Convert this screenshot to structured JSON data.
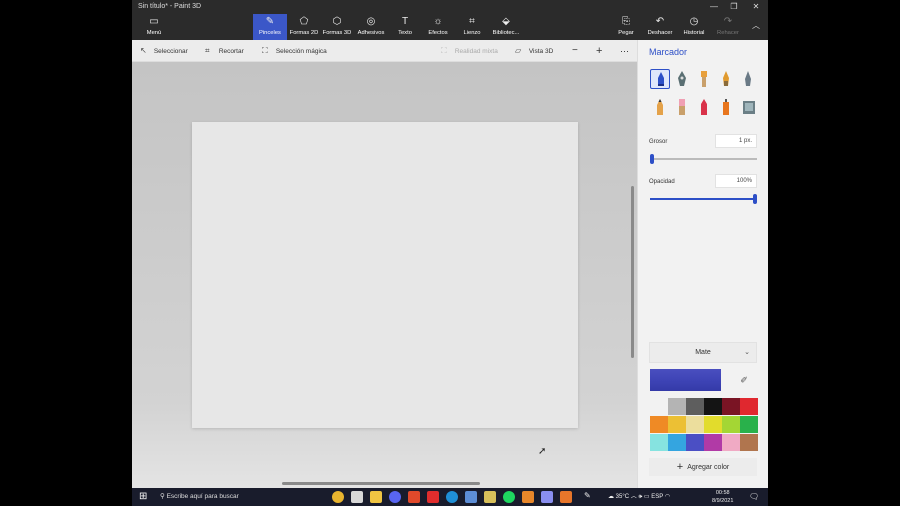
{
  "window": {
    "title": "Sin título* - Paint 3D"
  },
  "ribbon": {
    "menu": "Menú",
    "tools": [
      {
        "label": "Pinceles",
        "icon": "brush-icon"
      },
      {
        "label": "Formas 2D",
        "icon": "shapes-2d-icon"
      },
      {
        "label": "Formas 3D",
        "icon": "cube-icon"
      },
      {
        "label": "Adhesivos",
        "icon": "sticker-icon"
      },
      {
        "label": "Texto",
        "icon": "text-icon"
      },
      {
        "label": "Efectos",
        "icon": "effects-icon"
      },
      {
        "label": "Lienzo",
        "icon": "canvas-icon"
      },
      {
        "label": "Bibliotec...",
        "icon": "library-icon"
      }
    ],
    "paste": "Pegar",
    "undo": "Deshacer",
    "history": "Historial",
    "redo": "Rehacer"
  },
  "toolbar": {
    "select": "Seleccionar",
    "crop": "Recortar",
    "magic_select": "Selección mágica",
    "mixed_reality": "Realidad mixta",
    "view3d": "Vista 3D"
  },
  "panel": {
    "title": "Marcador",
    "thickness_label": "Grosor",
    "thickness_value": "1 px.",
    "thickness_fraction": 0.01,
    "opacity_label": "Opacidad",
    "opacity_value": "100%",
    "opacity_fraction": 1.0,
    "finish": "Mate",
    "current_color": "#3d43b5",
    "add_color": "Agregar color",
    "brushes": [
      "marker-icon",
      "calligraphy-pen-icon",
      "oil-brush-icon",
      "watercolor-icon",
      "pixel-pen-icon",
      "pencil-icon",
      "eraser-icon",
      "crayon-icon",
      "spray-can-icon",
      "fill-bucket-icon"
    ],
    "palette": [
      "#f2f2f2",
      "#b4b4b4",
      "#5e5e5e",
      "#141414",
      "#7a1424",
      "#e0282f",
      "#ef8a25",
      "#ecc034",
      "#ecde9d",
      "#e2dc2c",
      "#a4d634",
      "#29b14b",
      "#86e3e0",
      "#34a5e0",
      "#4b4fc4",
      "#b13aa6",
      "#f0aac4",
      "#b0754e"
    ]
  },
  "taskbar": {
    "search_placeholder": "Escribe aquí para buscar",
    "temperature": "35°C",
    "language": "ESP",
    "time": "00:58",
    "date": "8/9/2021"
  }
}
